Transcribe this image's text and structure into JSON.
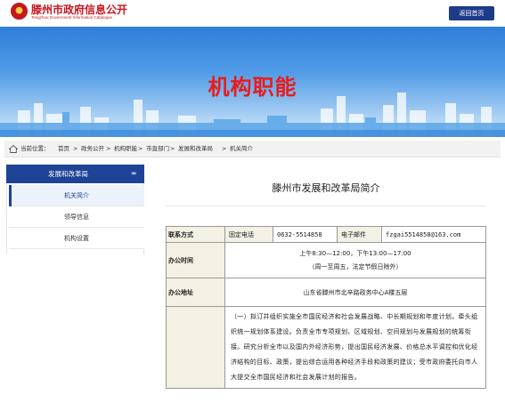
{
  "header": {
    "site_title": "滕州市政府信息公开",
    "site_subtitle": "Tengzhou Government Information Catalogue",
    "home_button": "返回首页"
  },
  "banner": {
    "title": "机构职能"
  },
  "breadcrumb": {
    "label": "当前位置：",
    "items": [
      "首页",
      "政务公开",
      "机构职能",
      "市直部门",
      "发展和改革局",
      "机关简介"
    ],
    "separator": ">"
  },
  "sidebar": {
    "heading": "发展和改革局",
    "heading_chevron": "»»",
    "items": [
      {
        "label": "机关简介",
        "active": true
      },
      {
        "label": "领导信息",
        "active": false
      },
      {
        "label": "机构设置",
        "active": false
      }
    ]
  },
  "content": {
    "title": "滕州市发展和改革局简介",
    "table": {
      "contact_label": "联系方式",
      "phone_label": "固定电话",
      "phone_value": "0632-5514858",
      "email_label": "电子邮件",
      "email_value": "fzgai5514858@163.com",
      "hours_label": "办公时间",
      "hours_line1": "上午8:30—12:00，下午13:00—17:00",
      "hours_line2": "（周一至周五，法定节假日除外）",
      "address_label": "办公地址",
      "address_value": "山东省滕州市北辛路政务中心A楼五层",
      "duty_text": "（一）拟订并组织实施全市国民经济和社会发展战略、中长期规划和年度计划。牵头组织统一规划体系建设。负责全市专项规划、区域规划、空间规划与发展规划的统筹衔接。研究分析全市以及国内外经济形势，提出国民经济发展、价格总水平调控和优化经济结构的目标、政策，提出综合运用各种经济手段和政策的建议；受市政府委托向市人大提交全市国民经济和社会发展计划的报告。"
    }
  },
  "colors": {
    "brand_red": "#c8161d",
    "nav_blue": "#1e4396",
    "banner_title_red": "#ea1b1b"
  }
}
